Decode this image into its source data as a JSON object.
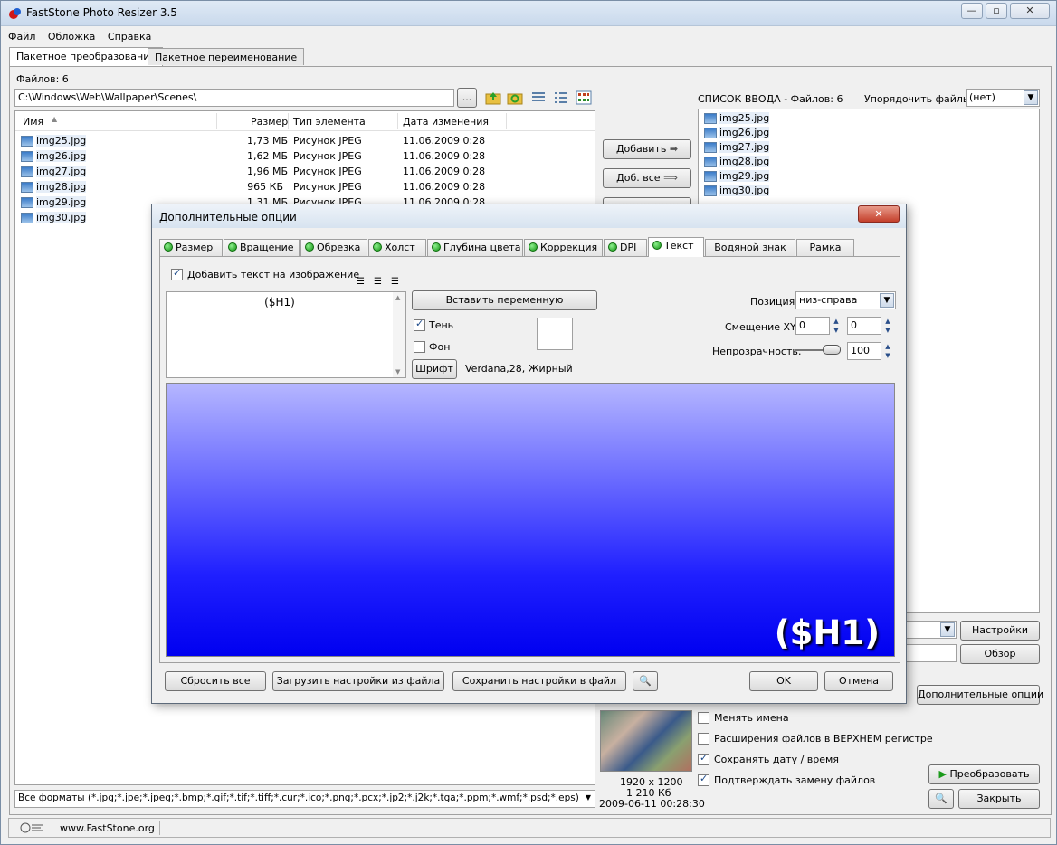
{
  "app": {
    "title": "FastStone Photo Resizer 3.5"
  },
  "menu": [
    "Файл",
    "Обложка",
    "Справка"
  ],
  "main_tabs": [
    "Пакетное преобразование",
    "Пакетное переименование"
  ],
  "files_count_label": "Файлов: 6",
  "path": "C:\\Windows\\Web\\Wallpaper\\Scenes\\",
  "browse_label": "...",
  "file_table": {
    "headers": [
      "Имя",
      "Размер",
      "Тип элемента",
      "Дата изменения"
    ],
    "rows": [
      {
        "name": "img25.jpg",
        "size": "1,73 МБ",
        "type": "Рисунок JPEG",
        "date": "11.06.2009 0:28"
      },
      {
        "name": "img26.jpg",
        "size": "1,62 МБ",
        "type": "Рисунок JPEG",
        "date": "11.06.2009 0:28"
      },
      {
        "name": "img27.jpg",
        "size": "1,96 МБ",
        "type": "Рисунок JPEG",
        "date": "11.06.2009 0:28"
      },
      {
        "name": "img28.jpg",
        "size": "965 КБ",
        "type": "Рисунок JPEG",
        "date": "11.06.2009 0:28"
      },
      {
        "name": "img29.jpg",
        "size": "1,31 МБ",
        "type": "Рисунок JPEG",
        "date": "11.06.2009 0:28"
      },
      {
        "name": "img30.jpg",
        "size": "",
        "type": "",
        "date": ""
      }
    ]
  },
  "format_filter": "Все форматы (*.jpg;*.jpe;*.jpeg;*.bmp;*.gif;*.tif;*.tiff;*.cur;*.ico;*.png;*.pcx;*.jp2;*.j2k;*.tga;*.ppm;*.wmf;*.psd;*.eps)",
  "middle_buttons": {
    "add": "Добавить",
    "add_all": "Доб. все"
  },
  "input_list": {
    "title": "СПИСОК ВВОДА  -  Файлов: 6",
    "sort_label": "Упорядочить файлы:",
    "sort_value": "(нет)",
    "items": [
      "img25.jpg",
      "img26.jpg",
      "img27.jpg",
      "img28.jpg",
      "img29.jpg",
      "img30.jpg"
    ]
  },
  "right_buttons": {
    "settings": "Настройки",
    "browse": "Обзор",
    "advanced": "Дополнительные опции",
    "convert": "Преобразовать",
    "close": "Закрыть"
  },
  "options": [
    {
      "label": "Менять имена",
      "checked": false
    },
    {
      "label": "Расширения файлов в ВЕРХНЕМ регистре",
      "checked": false
    },
    {
      "label": "Сохранять дату / время",
      "checked": true
    },
    {
      "label": "Подтверждать замену файлов",
      "checked": true
    }
  ],
  "thumb_info": {
    "dims": "1920 x 1200",
    "size": "1 210 Кб",
    "date": "2009-06-11 00:28:30"
  },
  "status": {
    "url": "www.FastStone.org"
  },
  "dialog": {
    "title": "Дополнительные опции",
    "tabs": [
      {
        "label": "Размер",
        "dot": true
      },
      {
        "label": "Вращение",
        "dot": true
      },
      {
        "label": "Обрезка",
        "dot": true
      },
      {
        "label": "Холст",
        "dot": true
      },
      {
        "label": "Глубина цвета",
        "dot": true
      },
      {
        "label": "Коррекция",
        "dot": true
      },
      {
        "label": "DPI",
        "dot": true
      },
      {
        "label": "Текст",
        "dot": true
      },
      {
        "label": "Водяной знак",
        "dot": false
      },
      {
        "label": "Рамка",
        "dot": false
      }
    ],
    "add_text_label": "Добавить текст на изображение",
    "text_value": "($H1)",
    "insert_variable": "Вставить переменную",
    "shadow_label": "Тень",
    "background_label": "Фон",
    "font_button": "Шрифт",
    "font_value": "Verdana,28, Жирный",
    "position_label": "Позиция:",
    "position_value": "низ-справа",
    "offset_label": "Смещение XY:",
    "offset_x": "0",
    "offset_y": "0",
    "opacity_label": "Непрозрачность:",
    "opacity_value": "100",
    "preview_text": "($H1)",
    "buttons": {
      "reset": "Сбросить все",
      "load": "Загрузить настройки из файла",
      "save": "Сохранить настройки в файл",
      "ok": "OK",
      "cancel": "Отмена"
    }
  }
}
